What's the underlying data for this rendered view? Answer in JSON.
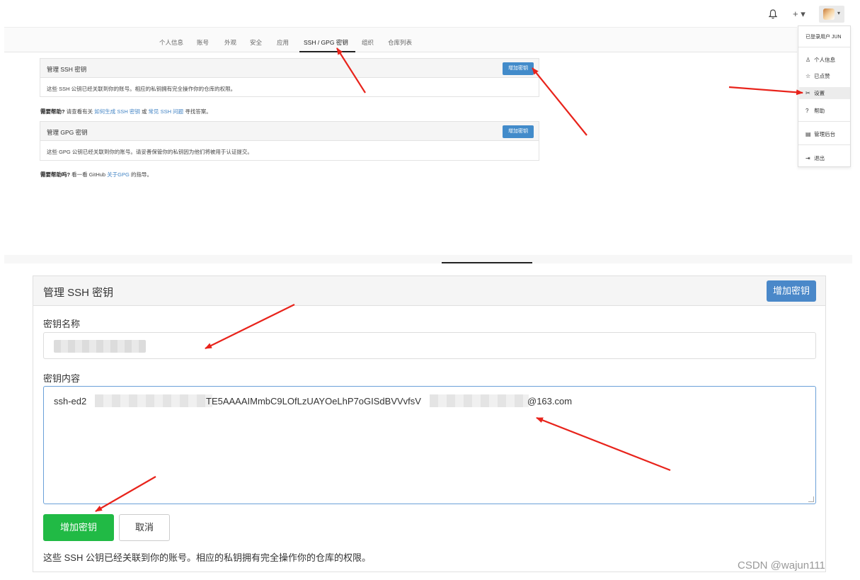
{
  "topbar": {
    "plus_label": "+ ▾"
  },
  "nav": {
    "tabs": [
      "个人信息",
      "账号",
      "外观",
      "安全",
      "应用",
      "SSH / GPG 密钥",
      "组织",
      "仓库列表"
    ],
    "active_tab": "SSH / GPG 密钥"
  },
  "ssh_small": {
    "title": "管理 SSH 密钥",
    "add_button": "增加密钥",
    "body": "这些 SSH 公钥已经关联到你的账号。相应的私钥拥有完全操作你的仓库的权限。"
  },
  "ssh_help": {
    "prefix": "需要帮助?",
    "text1": " 请查看有关 ",
    "link1": "如何生成 SSH 密钥",
    "text2": " 或 ",
    "link2": "常见 SSH 问题",
    "text3": " 寻找答案。"
  },
  "gpg_small": {
    "title": "管理 GPG 密钥",
    "add_button": "增加密钥",
    "body": "这些 GPG 公钥已经关联到你的账号。请妥善保管你的私钥因为他们将被用于认证提交。"
  },
  "gpg_help": {
    "prefix": "需要帮助吗?",
    "text1": " 看一看 GitHub ",
    "link1": "关于GPG",
    "text2": " 的指导。"
  },
  "dropdown": {
    "header": "已登录用户 JUN",
    "items": [
      {
        "icon": "person-icon",
        "glyph": "♙",
        "label": "个人信息"
      },
      {
        "icon": "star-icon",
        "glyph": "☆",
        "label": "已点赞"
      },
      {
        "icon": "tools-icon",
        "glyph": "✂",
        "label": "设置"
      },
      {
        "icon": "question-icon",
        "glyph": "?",
        "label": "帮助"
      },
      {
        "icon": "server-icon",
        "glyph": "▤",
        "label": "管理后台"
      },
      {
        "icon": "signout-icon",
        "glyph": "⇥",
        "label": "退出"
      }
    ],
    "highlighted": "设置"
  },
  "form": {
    "title": "管理 SSH 密钥",
    "add_top_button": "增加密钥",
    "name_label": "密钥名称",
    "content_label": "密钥内容",
    "content_visible_a": "ssh-ed2",
    "content_visible_b": "TE5AAAAIMmbC9LOfLzUAYOeLhP7oGISdBVVvfsV",
    "content_visible_c": "@163.com",
    "submit_button": "增加密钥",
    "cancel_button": "取消",
    "footer": "这些 SSH 公钥已经关联到你的账号。相应的私钥拥有完全操作你的仓库的权限。"
  },
  "watermark": "CSDN @wajun111",
  "colors": {
    "primary_blue": "#428bca",
    "green": "#21ba45",
    "arrow_red": "#e8231b"
  }
}
